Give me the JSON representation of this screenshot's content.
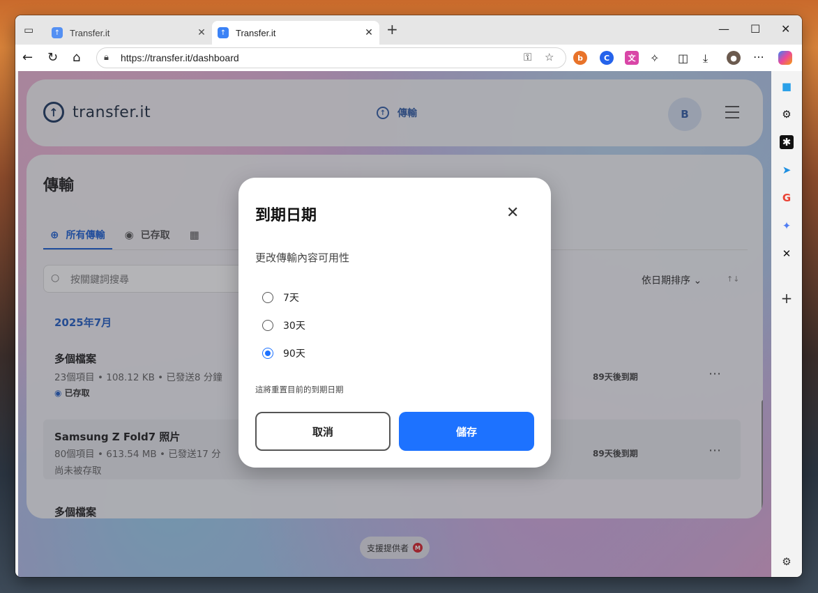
{
  "browser": {
    "tabs": [
      {
        "title": "Transfer.it"
      },
      {
        "title": "Transfer.it"
      }
    ],
    "url": "https://transfer.it/dashboard"
  },
  "site": {
    "logo": "transfer.it",
    "nav_label": "傳輸",
    "avatar_initial": "B"
  },
  "panel": {
    "title": "傳輸",
    "tabs": [
      {
        "label": "所有傳輸"
      },
      {
        "label": "已存取"
      }
    ],
    "search_placeholder": "按關鍵詞搜尋",
    "sort_label": "依日期排序",
    "month": "2025年7月",
    "rows": [
      {
        "name": "多個檔案",
        "meta": "23個項目  •  108.12 KB  •  已發送8 分鐘",
        "status": "已存取",
        "expiry": "89天後到期"
      },
      {
        "name": "Samsung Z Fold7 照片",
        "meta": "80個項目  •  613.54 MB  •  已發送17 分",
        "status": "尚未被存取",
        "expiry": "89天後到期"
      },
      {
        "name": "多個檔案"
      }
    ]
  },
  "support_label": "支援提供者",
  "modal": {
    "title": "到期日期",
    "subtitle": "更改傳輸內容可用性",
    "options": [
      {
        "label": "7天",
        "selected": false
      },
      {
        "label": "30天",
        "selected": false
      },
      {
        "label": "90天",
        "selected": true
      }
    ],
    "note": "這將重置目前的到期日期",
    "cancel": "取消",
    "save": "儲存"
  },
  "colors": {
    "accent": "#1d72ff",
    "brand_dark": "#1f3b63"
  }
}
